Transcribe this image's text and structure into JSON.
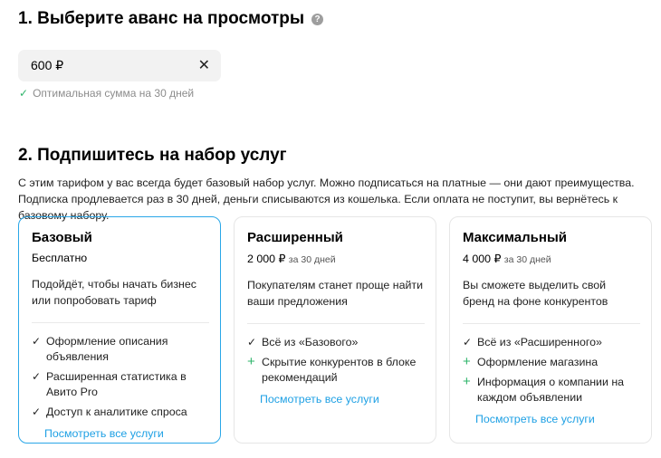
{
  "section1": {
    "title": "1. Выберите аванс на просмотры",
    "help_icon": "?",
    "amount_value": "600 ₽",
    "clear_icon": "✕",
    "hint_icon": "✓",
    "hint": "Оптимальная сумма на 30 дней"
  },
  "section2": {
    "title": "2. Подпишитесь на набор услуг",
    "description": "С этим тарифом у вас всегда будет базовый набор услуг. Можно подписаться на платные — они дают преимущества. Подписка продлевается раз в 30 дней, деньги списываются из кошелька. Если оплата не поступит, вы вернётесь к базовому набору."
  },
  "colors": {
    "accent": "#2aa7e8",
    "link": "#1ea0e4",
    "plus": "#2fb46b"
  },
  "cards": [
    {
      "title": "Базовый",
      "price": "Бесплатно",
      "per": "",
      "text": "Подойдёт, чтобы начать бизнес или попробовать тариф",
      "features": [
        {
          "icon": "✓",
          "label": "Оформление описания объявления"
        },
        {
          "icon": "✓",
          "label": "Расширенная статистика в Авито Pro"
        },
        {
          "icon": "✓",
          "label": "Доступ к аналитике спроса"
        }
      ],
      "link": "Посмотреть все услуги"
    },
    {
      "title": "Расширенный",
      "price": "2 000 ₽",
      "per": "за 30 дней",
      "text": "Покупателям станет проще найти ваши предложения",
      "features": [
        {
          "icon": "✓",
          "label": "Всё из «Базового»"
        },
        {
          "icon": "+",
          "label": "Скрытие конкурентов в блоке рекомендаций"
        }
      ],
      "link": "Посмотреть все услуги"
    },
    {
      "title": "Максимальный",
      "price": "4 000 ₽",
      "per": "за 30 дней",
      "text": "Вы сможете выделить свой бренд на фоне конкурентов",
      "features": [
        {
          "icon": "✓",
          "label": "Всё из «Расширенного»"
        },
        {
          "icon": "+",
          "label": "Оформление магазина"
        },
        {
          "icon": "+",
          "label": "Информация о компании на каждом объявлении"
        }
      ],
      "link": "Посмотреть все услуги"
    }
  ]
}
